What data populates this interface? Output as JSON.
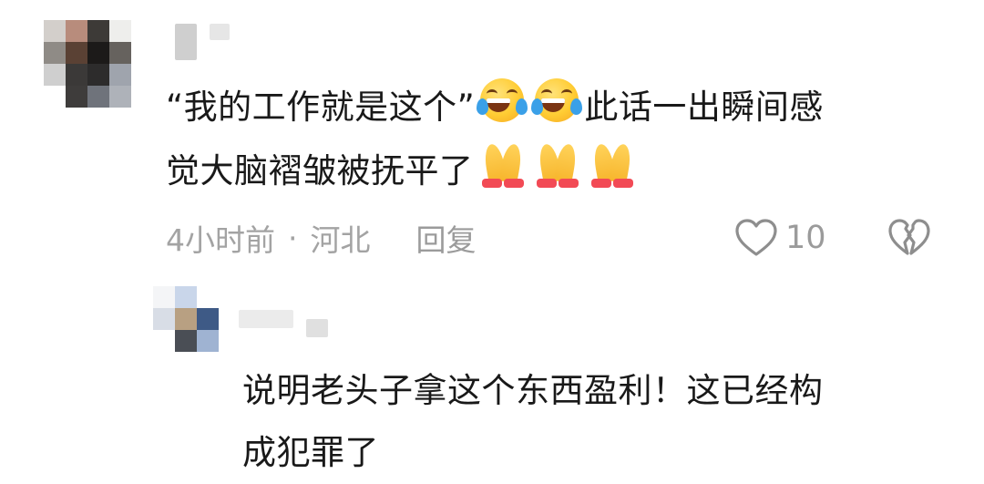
{
  "comment": {
    "text_line1_before": "“我的工作就是这个”",
    "text_line1_after": "此话一出瞬间感",
    "text_line2": "觉大脑褶皱被抚平了",
    "time": "4小时前",
    "separator": "·",
    "location": "河北",
    "reply_label": "回复",
    "like_count": "10",
    "icons": {
      "emoji_1": "face-with-tears-of-joy-icon",
      "emoji_2": "folded-hands-icon",
      "like": "heart-outline-icon",
      "dislike": "broken-heart-outline-icon"
    }
  },
  "reply": {
    "text_line1": "说明老头子拿这个东西盈利！这已经构",
    "text_line2": "成犯罪了"
  },
  "colors": {
    "text": "#191919",
    "meta": "#a3a3a3",
    "icon": "#8e8e8e",
    "emoji_yellow": "#ffcc33",
    "tear_blue": "#3aa0e8",
    "cuff_red": "#f24a55"
  }
}
